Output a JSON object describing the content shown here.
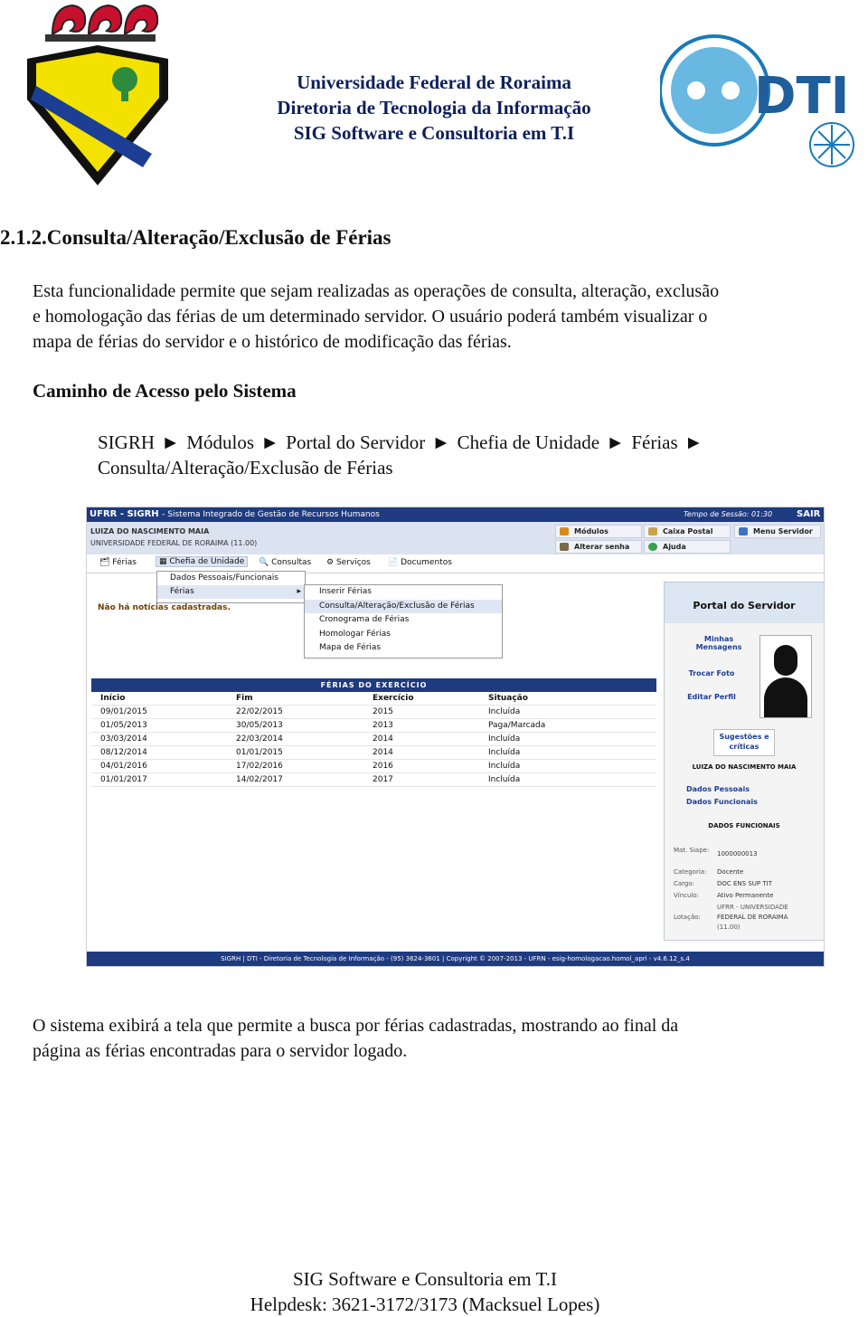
{
  "header": {
    "line1": "Universidade Federal de Roraima",
    "line2": "Diretoria de Tecnologia da Informação",
    "line3": "SIG Software e Consultoria em T.I",
    "logo_right_text": "DTI",
    "colors": {
      "header_text": "#0d1f5c",
      "brand_blue": "#1f3b80"
    }
  },
  "section_title": "2.1.2.Consulta/Alteração/Exclusão de Férias",
  "intro": {
    "line1": "Esta funcionalidade permite que sejam realizadas as operações de consulta, alteração, exclusão",
    "line2": "e homologação das férias de um determinado servidor. O usuário poderá também visualizar o",
    "line3": "mapa de férias do servidor e o histórico de modificação das férias."
  },
  "caminho": {
    "heading": "Caminho de Acesso pelo Sistema",
    "steps": [
      "SIGRH",
      "Módulos",
      "Portal do Servidor",
      "Chefia de Unidade",
      "Férias",
      "Consulta/Alteração/Exclusão de Férias"
    ],
    "separator": "►"
  },
  "screenshot": {
    "topbar": {
      "title": "UFRR - SIGRH",
      "subtitle": "- Sistema Integrado de Gestão de Recursos Humanos",
      "session": "Tempo de Sessão: 01:30",
      "exit": "SAIR"
    },
    "user": {
      "name": "LUIZA DO NASCIMENTO MAIA",
      "unit": "UNIVERSIDADE FEDERAL DE RORAIMA (11.00)"
    },
    "buttons": {
      "modulos": "Módulos",
      "caixa_postal": "Caixa Postal",
      "menu_servidor": "Menu Servidor",
      "alterar_senha": "Alterar senha",
      "ajuda": "Ajuda"
    },
    "menu": {
      "ferias": "Férias",
      "chefia": "Chefia de Unidade",
      "consultas": "Consultas",
      "servicos": "Serviços",
      "documentos": "Documentos"
    },
    "dropdown1": [
      "Dados Pessoais/Funcionais",
      "Férias"
    ],
    "dropdown2": [
      "Inserir Férias",
      "Consulta/Alteração/Exclusão de Férias",
      "Cronograma de Férias",
      "Homologar Férias",
      "Mapa de Férias"
    ],
    "news": "Não há notícias cadastradas.",
    "table": {
      "caption": "FÉRIAS DO EXERCÍCIO",
      "headers": [
        "Início",
        "Fim",
        "Exercício",
        "Situação"
      ],
      "rows": [
        [
          "09/01/2015",
          "22/02/2015",
          "2015",
          "Incluída"
        ],
        [
          "01/05/2013",
          "30/05/2013",
          "2013",
          "Paga/Marcada"
        ],
        [
          "03/03/2014",
          "22/03/2014",
          "2014",
          "Incluída"
        ],
        [
          "08/12/2014",
          "01/01/2015",
          "2014",
          "Incluída"
        ],
        [
          "04/01/2016",
          "17/02/2016",
          "2016",
          "Incluída"
        ],
        [
          "01/01/2017",
          "14/02/2017",
          "2017",
          "Incluída"
        ]
      ]
    },
    "portal": {
      "title": "Portal do Servidor",
      "minhas_mensagens": "Minhas Mensagens",
      "trocar_foto": "Trocar Foto",
      "editar_perfil": "Editar Perfil",
      "sugestoes": "Sugestões e críticas",
      "name": "LUIZA DO NASCIMENTO MAIA",
      "dados_pessoais": "Dados Pessoais",
      "dados_funcionais": "Dados Funcionais",
      "dados_heading": "DADOS FUNCIONAIS",
      "mat_label": "Mat. Siape:",
      "mat_value": "1000000013",
      "categoria_label": "Categoria:",
      "categoria_value": "Docente",
      "cargo_label": "Cargo:",
      "cargo_value": "DOC ENS SUP TIT",
      "vinculo_label": "Vínculo:",
      "vinculo_value": "Ativo Permanente",
      "lotacao_label": "Lotação:",
      "lotacao_value1": "UFRR - UNIVERSIDADE",
      "lotacao_value2": "FEDERAL DE RORAIMA",
      "lotacao_value3": "(11.00)"
    },
    "footer": "SIGRH | DTI - Diretoria de Tecnologia de Informação - (95) 3624-3601 | Copyright © 2007-2013 - UFRN - esig-homologacao.homol_apri - v4.6.12_s.4"
  },
  "result_text": {
    "line1": "O sistema exibirá a tela que permite a busca por férias cadastradas, mostrando ao final da",
    "line2": "página as férias encontradas para o servidor logado."
  },
  "footer": {
    "line1": "SIG Software e Consultoria em T.I",
    "line2": "Helpdesk: 3621-3172/3173 (Macksuel Lopes)"
  }
}
